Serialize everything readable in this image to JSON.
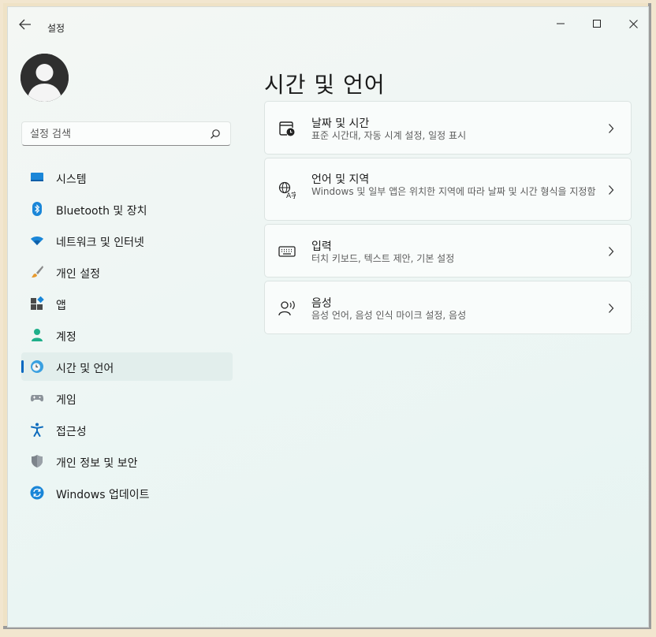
{
  "app": {
    "title": "설정"
  },
  "search": {
    "placeholder": "설정 검색",
    "value": ""
  },
  "sidebar": {
    "items": [
      {
        "label": "시스템",
        "icon": "monitor-icon"
      },
      {
        "label": "Bluetooth 및 장치",
        "icon": "bluetooth-icon"
      },
      {
        "label": "네트워크 및 인터넷",
        "icon": "wifi-icon"
      },
      {
        "label": "개인 설정",
        "icon": "paintbrush-icon"
      },
      {
        "label": "앱",
        "icon": "apps-icon"
      },
      {
        "label": "계정",
        "icon": "person-icon"
      },
      {
        "label": "시간 및 언어",
        "icon": "clock-globe-icon",
        "selected": true
      },
      {
        "label": "게임",
        "icon": "gamepad-icon"
      },
      {
        "label": "접근성",
        "icon": "accessibility-icon"
      },
      {
        "label": "개인 정보 및 보안",
        "icon": "shield-icon"
      },
      {
        "label": "Windows 업데이트",
        "icon": "update-icon"
      }
    ]
  },
  "main": {
    "title": "시간 및 언어",
    "cards": [
      {
        "title": "날짜 및 시간",
        "desc": "표준 시간대, 자동 시계 설정, 일정 표시",
        "icon": "calendar-clock-icon"
      },
      {
        "title": "언어 및 지역",
        "desc": "Windows 및 일부 앱은 위치한 지역에 따라 날짜 및 시간 형식을 지정함",
        "icon": "language-icon"
      },
      {
        "title": "입력",
        "desc": "터치 키보드, 텍스트 제안, 기본 설정",
        "icon": "keyboard-icon"
      },
      {
        "title": "음성",
        "desc": "음성 언어, 음성 인식 마이크 설정, 음성",
        "icon": "speech-icon"
      }
    ]
  },
  "colors": {
    "accent": "#0067c0",
    "selected_bg": "#e2eeec"
  }
}
